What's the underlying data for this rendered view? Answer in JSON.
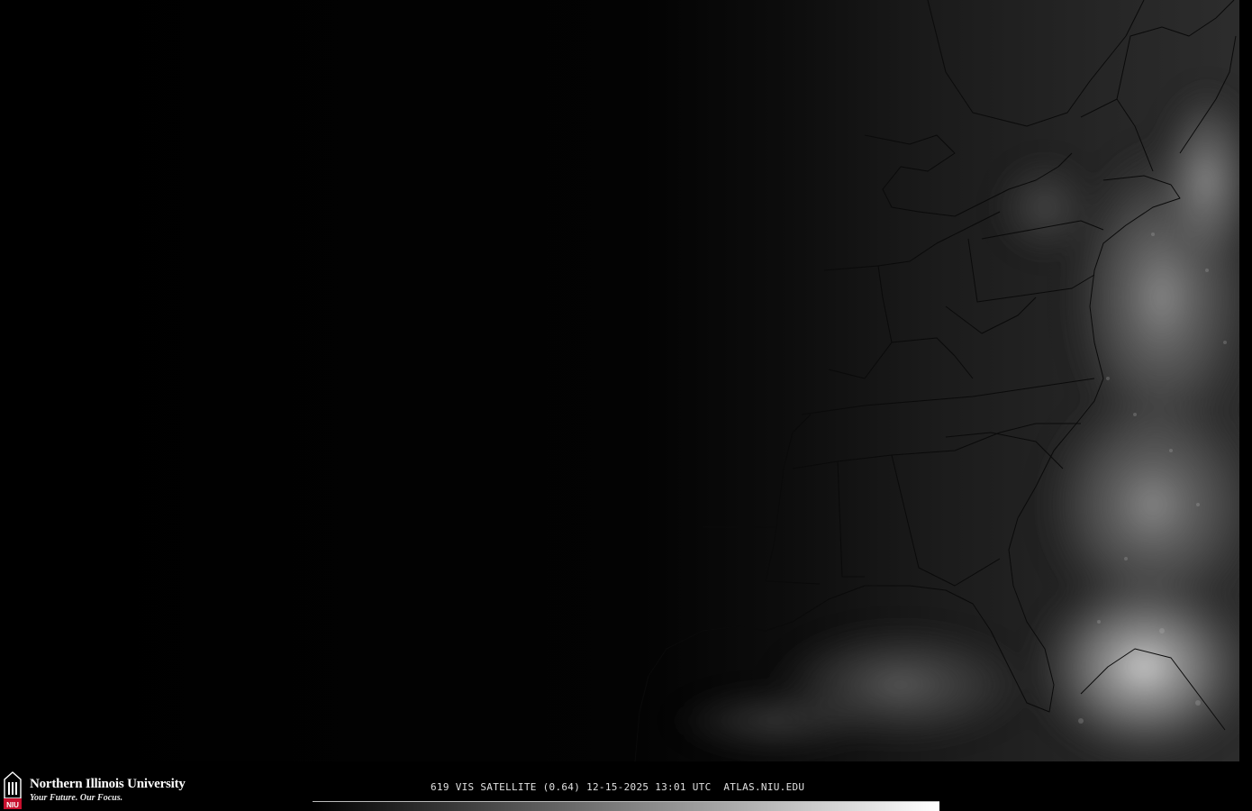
{
  "colors": {
    "background": "#000000",
    "land_borders": "#111111",
    "cloud_light": "#cfcfcf",
    "colorbar_start": "#000000",
    "colorbar_end": "#ffffff",
    "logo_red": "#c8102e"
  },
  "footer": {
    "logo": {
      "icon": "niu-tower-icon",
      "monogram": "NIU",
      "name": "Northern Illinois University",
      "tagline": "Your Future. Our Focus."
    },
    "caption": "619 VIS SATELLITE (0.64) 12-15-2025 13:01 UTC  ATLAS.NIU.EDU"
  }
}
